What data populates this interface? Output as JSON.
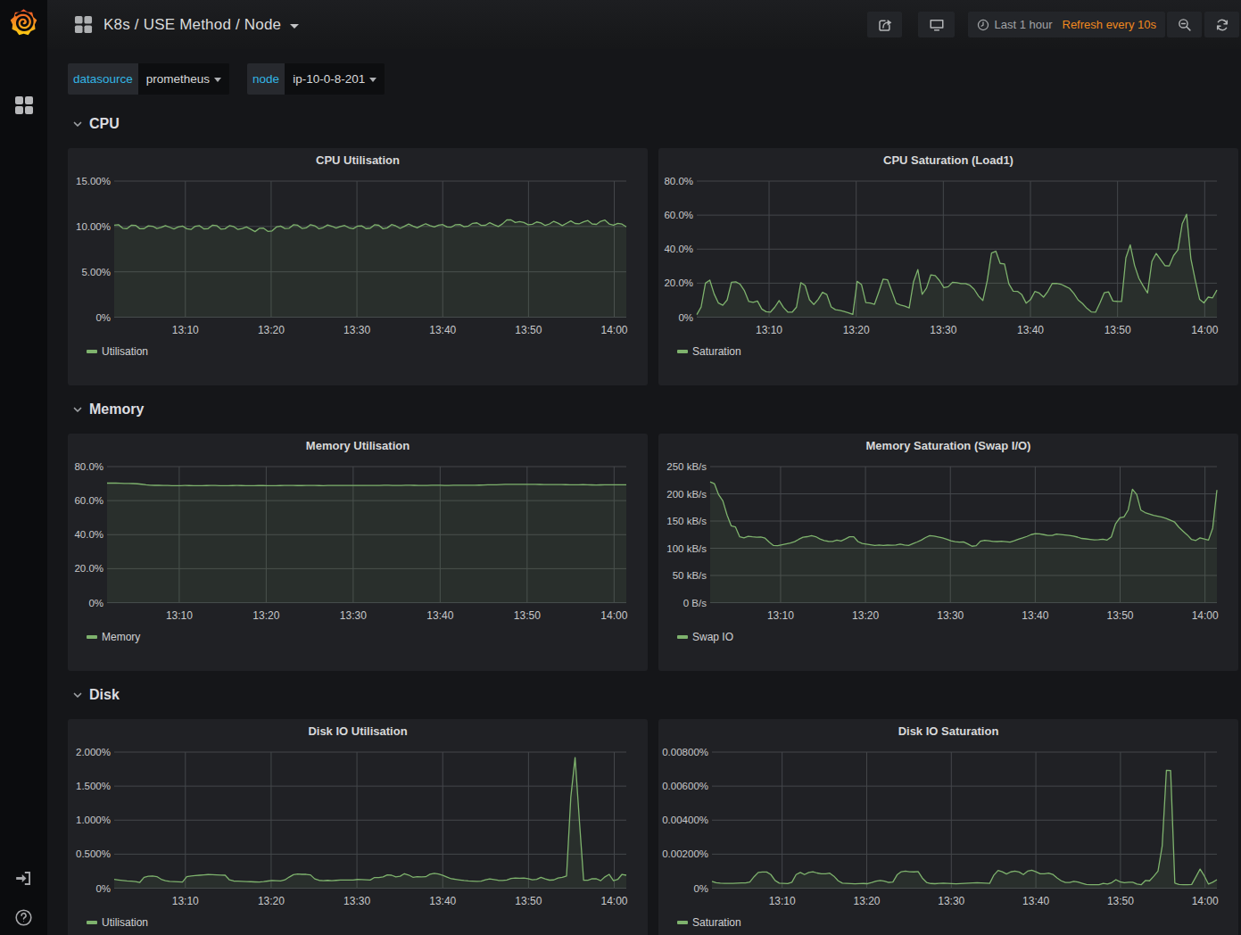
{
  "colors": {
    "page_bg": "#151619",
    "panel_bg": "#202125",
    "sidebar_bg": "#0b0c0e",
    "text": "#d8d9da",
    "muted_text": "#9fa1a4",
    "tick_text": "#c8c9cb",
    "grid": "#44474b",
    "series_green": "#7eb26d",
    "variable_label": "#33b5e5",
    "refresh_orange": "#f0891f"
  },
  "sidebar": {
    "logo": "grafana-logo",
    "items": [
      {
        "label": "Dashboards",
        "icon": "apps-grid-icon"
      }
    ],
    "bottom_items": [
      {
        "label": "Sign In",
        "icon": "sign-in-icon"
      },
      {
        "label": "Help",
        "icon": "help-icon"
      }
    ]
  },
  "navbar": {
    "title": "K8s / USE Method / Node",
    "title_icon": "apps-grid-icon",
    "actions": [
      {
        "name": "share",
        "icon": "share-icon"
      },
      {
        "name": "cycle-view-mode",
        "icon": "monitor-icon"
      }
    ],
    "timepicker": {
      "icon": "clock-icon",
      "range_label": "Last 1 hour",
      "refresh_label": "Refresh every 10s"
    },
    "zoom_out_icon": "zoom-out-icon",
    "refresh_icon": "refresh-icon"
  },
  "submenu": {
    "variables": [
      {
        "label": "datasource",
        "value": "prometheus"
      },
      {
        "label": "node",
        "value": "ip-10-0-8-201"
      }
    ]
  },
  "rows": [
    {
      "title": "CPU",
      "charts": [
        0,
        1
      ]
    },
    {
      "title": "Memory",
      "charts": [
        2,
        3
      ]
    },
    {
      "title": "Disk",
      "charts": [
        4,
        5
      ]
    }
  ],
  "chart_data": [
    {
      "type": "line",
      "title": "CPU Utilisation",
      "legend": "Utilisation",
      "unit": "percent",
      "ylim": [
        0,
        15
      ],
      "y_ticks": [
        {
          "label": "15.00%",
          "v": 15
        },
        {
          "label": "10.00%",
          "v": 10
        },
        {
          "label": "5.00%",
          "v": 5
        },
        {
          "label": "0%",
          "v": 0
        }
      ],
      "x_ticks": [
        {
          "label": "13:10",
          "f": 0.139
        },
        {
          "label": "13:20",
          "f": 0.3065
        },
        {
          "label": "13:30",
          "f": 0.474
        },
        {
          "label": "13:40",
          "f": 0.6415
        },
        {
          "label": "13:50",
          "f": 0.809
        },
        {
          "label": "14:00",
          "f": 0.9765
        }
      ],
      "x_range": [
        "13:02",
        "14:02"
      ],
      "plot_left": 52,
      "values": [
        10.15,
        10.2,
        9.8,
        9.76,
        10.13,
        10.12,
        9.75,
        9.76,
        10.07,
        10.03,
        9.78,
        9.89,
        10.09,
        9.91,
        9.73,
        9.95,
        10.05,
        9.75,
        9.67,
        10.03,
        10.09,
        9.74,
        9.76,
        10.14,
        10.1,
        9.71,
        9.75,
        10.09,
        9.99,
        9.67,
        9.78,
        9.95,
        9.7,
        9.43,
        9.79,
        9.81,
        9.46,
        9.51,
        9.94,
        10.04,
        9.77,
        9.8,
        10.19,
        10.14,
        9.78,
        9.84,
        10.2,
        10.08,
        9.74,
        9.88,
        10.17,
        10.03,
        9.82,
        9.99,
        10.11,
        9.86,
        9.75,
        10.04,
        10.07,
        9.76,
        9.81,
        10.19,
        10.13,
        9.75,
        9.85,
        10.21,
        10.06,
        9.79,
        10.02,
        10.27,
        10.05,
        9.85,
        10.09,
        10.3,
        10.1,
        9.95,
        10.15,
        10.21,
        9.95,
        9.93,
        10.2,
        10.21,
        9.97,
        10.05,
        10.35,
        10.4,
        10.12,
        10.13,
        10.42,
        10.2,
        10.0,
        10.29,
        10.73,
        10.72,
        10.44,
        10.53,
        10.44,
        10.2,
        10.24,
        10.5,
        10.39,
        10.11,
        10.28,
        10.57,
        10.36,
        10.09,
        10.35,
        10.61,
        10.33,
        10.3,
        10.52,
        10.65,
        10.28,
        10.23,
        10.57,
        10.7,
        10.27,
        10.15,
        10.35,
        10.26,
        9.96
      ]
    },
    {
      "type": "line",
      "title": "CPU Saturation (Load1)",
      "legend": "Saturation",
      "unit": "percent",
      "ylim": [
        0,
        80
      ],
      "y_ticks": [
        {
          "label": "80.0%",
          "v": 80
        },
        {
          "label": "60.0%",
          "v": 60
        },
        {
          "label": "40.0%",
          "v": 40
        },
        {
          "label": "20.0%",
          "v": 20
        },
        {
          "label": "0%",
          "v": 0
        }
      ],
      "x_ticks": [
        {
          "label": "13:10",
          "f": 0.139
        },
        {
          "label": "13:20",
          "f": 0.3065
        },
        {
          "label": "13:30",
          "f": 0.474
        },
        {
          "label": "13:40",
          "f": 0.6415
        },
        {
          "label": "13:50",
          "f": 0.809
        },
        {
          "label": "14:00",
          "f": 0.9765
        }
      ],
      "x_range": [
        "13:02",
        "14:02"
      ],
      "plot_left": 43,
      "values": [
        1.5,
        6.0,
        20.0,
        21.8,
        13.7,
        8.3,
        7.0,
        10.1,
        20.5,
        20.8,
        19.4,
        15.5,
        9.2,
        8.7,
        9.5,
        4.8,
        3.2,
        3.0,
        5.9,
        9.8,
        5.7,
        3.0,
        2.9,
        5.9,
        20.3,
        18.6,
        10.2,
        7.5,
        10.4,
        14.6,
        13.3,
        6.0,
        4.4,
        4.0,
        3.4,
        2.6,
        1.6,
        21.1,
        19.2,
        8.6,
        8.3,
        7.6,
        14.8,
        22.4,
        22.0,
        15.2,
        8.2,
        7.2,
        6.5,
        5.4,
        20.7,
        28.0,
        13.5,
        17.1,
        24.9,
        24.5,
        21.5,
        17.4,
        17.9,
        20.5,
        20.3,
        19.7,
        19.7,
        18.8,
        16.4,
        12.4,
        9.8,
        21.3,
        37.7,
        38.8,
        31.6,
        31.3,
        19.6,
        15.3,
        15.2,
        13.2,
        8.2,
        10.3,
        15.1,
        14.2,
        11.8,
        15.2,
        19.8,
        19.9,
        19.4,
        18.2,
        16.9,
        14.0,
        10.1,
        8.0,
        5.2,
        3.1,
        2.9,
        8.3,
        14.3,
        14.9,
        9.5,
        9.3,
        9.2,
        34.9,
        42.5,
        30.5,
        22.8,
        18.3,
        14.2,
        32.8,
        37.5,
        33.9,
        30.3,
        30.1,
        36.2,
        39.5,
        55.0,
        60.5,
        34.3,
        21.8,
        10.5,
        8.4,
        11.8,
        11.4,
        15.9
      ]
    },
    {
      "type": "line",
      "title": "Memory Utilisation",
      "legend": "Memory",
      "unit": "percent",
      "ylim": [
        0,
        80
      ],
      "y_ticks": [
        {
          "label": "80.0%",
          "v": 80
        },
        {
          "label": "60.0%",
          "v": 60
        },
        {
          "label": "40.0%",
          "v": 40
        },
        {
          "label": "20.0%",
          "v": 20
        },
        {
          "label": "0%",
          "v": 0
        }
      ],
      "x_ticks": [
        {
          "label": "13:10",
          "f": 0.139
        },
        {
          "label": "13:20",
          "f": 0.3065
        },
        {
          "label": "13:30",
          "f": 0.474
        },
        {
          "label": "13:40",
          "f": 0.6415
        },
        {
          "label": "13:50",
          "f": 0.809
        },
        {
          "label": "14:00",
          "f": 0.9765
        }
      ],
      "x_range": [
        "13:02",
        "14:02"
      ],
      "plot_left": 44,
      "values": [
        70.3,
        70.34,
        70.3,
        70.19,
        70.1,
        70.06,
        70.04,
        69.9,
        69.63,
        69.33,
        69.09,
        68.98,
        68.98,
        68.95,
        68.9,
        68.83,
        68.8,
        68.83,
        68.87,
        68.86,
        68.8,
        68.77,
        68.78,
        68.85,
        68.9,
        68.87,
        68.81,
        68.76,
        68.77,
        68.84,
        68.87,
        68.86,
        68.82,
        68.79,
        68.81,
        68.85,
        68.85,
        68.82,
        68.78,
        68.79,
        68.85,
        68.91,
        68.91,
        68.88,
        68.85,
        68.85,
        68.89,
        68.91,
        68.88,
        68.84,
        68.83,
        68.87,
        68.93,
        68.96,
        68.94,
        68.9,
        68.9,
        68.93,
        68.97,
        68.96,
        68.9,
        68.87,
        68.89,
        68.95,
        69.0,
        69.0,
        68.96,
        68.94,
        68.97,
        69.01,
        69.02,
        68.98,
        68.92,
        68.91,
        68.96,
        69.02,
        69.05,
        69.01,
        68.96,
        68.96,
        69.0,
        69.06,
        69.07,
        69.04,
        69.02,
        69.05,
        69.12,
        69.22,
        69.26,
        69.28,
        69.33,
        69.45,
        69.58,
        69.62,
        69.61,
        69.56,
        69.55,
        69.57,
        69.59,
        69.57,
        69.5,
        69.43,
        69.41,
        69.44,
        69.46,
        69.43,
        69.37,
        69.32,
        69.32,
        69.36,
        69.37,
        69.32,
        69.25,
        69.22,
        69.24,
        69.31,
        69.35,
        69.31,
        69.26,
        69.28,
        69.35
      ]
    },
    {
      "type": "line",
      "title": "Memory Saturation (Swap I/O)",
      "legend": "Swap IO",
      "unit": "kB/s",
      "ylim": [
        0,
        250
      ],
      "y_ticks": [
        {
          "label": "250 kB/s",
          "v": 250
        },
        {
          "label": "200 kB/s",
          "v": 200
        },
        {
          "label": "150 kB/s",
          "v": 150
        },
        {
          "label": "100 kB/s",
          "v": 100
        },
        {
          "label": "50 kB/s",
          "v": 50
        },
        {
          "label": "0 B/s",
          "v": 0
        }
      ],
      "x_ticks": [
        {
          "label": "13:10",
          "f": 0.139
        },
        {
          "label": "13:20",
          "f": 0.3065
        },
        {
          "label": "13:30",
          "f": 0.474
        },
        {
          "label": "13:40",
          "f": 0.6415
        },
        {
          "label": "13:50",
          "f": 0.809
        },
        {
          "label": "14:00",
          "f": 0.9765
        }
      ],
      "x_range": [
        "13:02",
        "14:02"
      ],
      "plot_left": 58,
      "values": [
        222,
        218.8,
        198.5,
        187.2,
        161.0,
        141.0,
        139.0,
        121.0,
        119.0,
        122.0,
        121.0,
        120.2,
        120.7,
        118.5,
        111.0,
        105.0,
        104.7,
        106.3,
        108.0,
        109.7,
        112.0,
        116.5,
        120.3,
        121.3,
        123.0,
        121.3,
        117.0,
        114.0,
        112.7,
        112.5,
        115.0,
        113.3,
        117.0,
        121.0,
        121.0,
        112.3,
        108.7,
        107.5,
        106.3,
        105.2,
        106.0,
        105.2,
        105.7,
        105.5,
        106.0,
        107.7,
        106.0,
        105.2,
        108.3,
        111.5,
        115.0,
        119.7,
        123.0,
        122.2,
        120.7,
        119.0,
        116.7,
        113.7,
        112.0,
        111.2,
        111.7,
        108.0,
        103.7,
        104.7,
        113.0,
        114.7,
        113.7,
        112.5,
        112.3,
        112.8,
        112.0,
        111.2,
        113.7,
        116.5,
        119.0,
        121.7,
        125.0,
        126.7,
        126.3,
        125.0,
        123.7,
        123.5,
        126.0,
        125.2,
        124.3,
        123.5,
        122.3,
        120.5,
        118.0,
        117.2,
        116.3,
        115.5,
        115.7,
        116.7,
        115.0,
        120.8,
        145.0,
        156.0,
        157.7,
        170.5,
        208.3,
        199.0,
        170.0,
        165.5,
        163.0,
        160.5,
        158.7,
        157.0,
        154.7,
        151.3,
        148.0,
        138.5,
        131.3,
        124.3,
        116.0,
        114.3,
        119.0,
        117.0,
        115.0,
        137.0,
        207
      ]
    },
    {
      "type": "line",
      "title": "Disk IO Utilisation",
      "legend": "Utilisation",
      "unit": "percent",
      "ylim": [
        0,
        2
      ],
      "y_ticks": [
        {
          "label": "2.000%",
          "v": 2
        },
        {
          "label": "1.500%",
          "v": 1.5
        },
        {
          "label": "1.000%",
          "v": 1
        },
        {
          "label": "0.500%",
          "v": 0.5
        },
        {
          "label": "0%",
          "v": 0
        }
      ],
      "x_ticks": [
        {
          "label": "13:10",
          "f": 0.139
        },
        {
          "label": "13:20",
          "f": 0.3065
        },
        {
          "label": "13:30",
          "f": 0.474
        },
        {
          "label": "13:40",
          "f": 0.6415
        },
        {
          "label": "13:50",
          "f": 0.809
        },
        {
          "label": "14:00",
          "f": 0.9765
        }
      ],
      "x_range": [
        "13:02",
        "14:02"
      ],
      "plot_left": 52,
      "values": [
        0.13,
        0.121,
        0.113,
        0.106,
        0.103,
        0.098,
        0.085,
        0.16,
        0.175,
        0.179,
        0.17,
        0.131,
        0.11,
        0.099,
        0.096,
        0.093,
        0.09,
        0.168,
        0.18,
        0.185,
        0.19,
        0.195,
        0.2,
        0.198,
        0.195,
        0.193,
        0.19,
        0.122,
        0.105,
        0.103,
        0.1,
        0.098,
        0.095,
        0.092,
        0.09,
        0.096,
        0.105,
        0.114,
        0.11,
        0.106,
        0.122,
        0.163,
        0.199,
        0.208,
        0.203,
        0.203,
        0.195,
        0.136,
        0.115,
        0.111,
        0.115,
        0.111,
        0.115,
        0.12,
        0.12,
        0.12,
        0.12,
        0.128,
        0.127,
        0.123,
        0.12,
        0.157,
        0.155,
        0.165,
        0.195,
        0.19,
        0.167,
        0.175,
        0.213,
        0.193,
        0.16,
        0.168,
        0.165,
        0.168,
        0.205,
        0.217,
        0.207,
        0.188,
        0.163,
        0.138,
        0.13,
        0.121,
        0.112,
        0.106,
        0.103,
        0.101,
        0.104,
        0.122,
        0.137,
        0.127,
        0.115,
        0.112,
        0.12,
        0.142,
        0.15,
        0.146,
        0.148,
        0.138,
        0.122,
        0.129,
        0.16,
        0.135,
        0.118,
        0.121,
        0.15,
        0.158,
        0.18,
        1.34,
        1.92,
        1.0,
        0.117,
        0.117,
        0.138,
        0.138,
        0.11,
        0.166,
        0.203,
        0.11,
        0.128,
        0.203,
        0.19
      ]
    },
    {
      "type": "line",
      "title": "Disk IO Saturation",
      "legend": "Saturation",
      "unit": "percent",
      "ylim": [
        0,
        0.008
      ],
      "y_ticks": [
        {
          "label": "0.00800%",
          "v": 0.008
        },
        {
          "label": "0.00600%",
          "v": 0.006
        },
        {
          "label": "0.00400%",
          "v": 0.004
        },
        {
          "label": "0.00200%",
          "v": 0.002
        },
        {
          "label": "0%",
          "v": 0
        }
      ],
      "x_ticks": [
        {
          "label": "13:10",
          "f": 0.139
        },
        {
          "label": "13:20",
          "f": 0.3065
        },
        {
          "label": "13:30",
          "f": 0.474
        },
        {
          "label": "13:40",
          "f": 0.6415
        },
        {
          "label": "13:50",
          "f": 0.809
        },
        {
          "label": "14:00",
          "f": 0.9765
        }
      ],
      "x_range": [
        "13:02",
        "14:02"
      ],
      "plot_left": 60,
      "values": [
        0.0004,
        0.000317,
        0.00029,
        0.00028,
        0.00028,
        0.000287,
        0.0003,
        0.000313,
        0.000313,
        0.000362,
        0.000672,
        0.000925,
        0.00095,
        0.00095,
        0.0008,
        0.00045,
        0.000295,
        0.000282,
        0.00027,
        0.00035,
        0.0008,
        0.000925,
        0.0008,
        0.000925,
        0.000967,
        0.000892,
        0.00085,
        0.00085,
        0.000883,
        0.0007,
        0.000433,
        0.000297,
        0.000285,
        0.000272,
        0.00026,
        0.000272,
        0.000275,
        0.000263,
        0.00033,
        0.000408,
        0.00045,
        0.000408,
        0.00034,
        0.000364,
        0.000783,
        0.000969,
        0.001,
        0.000969,
        0.000957,
        0.000976,
        0.000593,
        0.00034,
        0.000275,
        0.000263,
        0.00028,
        0.000297,
        0.000285,
        0.000272,
        0.00026,
        0.000272,
        0.000285,
        0.000297,
        0.00031,
        0.000318,
        0.000305,
        0.000293,
        0.00028,
        0.00077,
        0.00104,
        0.00096,
        0.00083,
        0.000958,
        0.001,
        0.00095,
        0.0008,
        0.001,
        0.00105,
        0.000967,
        0.00085,
        0.00085,
        0.000883,
        0.000808,
        0.0006,
        0.000433,
        0.000333,
        0.000337,
        0.0004,
        0.000358,
        0.000285,
        0.000217,
        0.000205,
        0.0002,
        0.0002,
        0.000283,
        0.000247,
        0.000325,
        0.0005,
        0.000375,
        0.000317,
        0.00035,
        0.00035,
        0.000242,
        0.0002,
        0.00045,
        0.000433,
        0.0007,
        0.001007,
        0.00249,
        0.006925,
        0.006913,
        0.0003,
        0.000217,
        0.0002,
        0.000203,
        0.000215,
        0.00066,
        0.00112,
        0.000725,
        0.00024,
        0.00035,
        0.0005
      ]
    }
  ]
}
